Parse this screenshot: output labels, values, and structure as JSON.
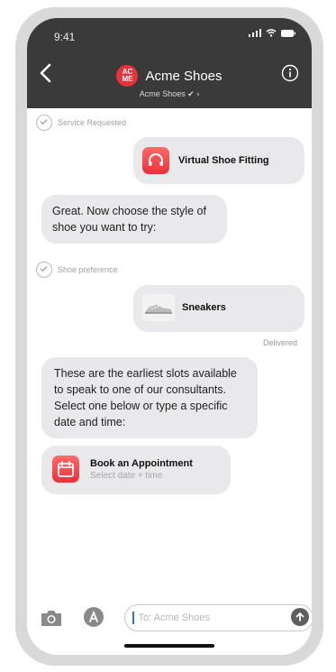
{
  "status_bar": {
    "time": "9:41"
  },
  "header": {
    "logo_text": "AC\nME",
    "title": "Acme Shoes",
    "subtitle": "Acme Shoes ✔ ›"
  },
  "messages": {
    "service_status": "Service Requested",
    "virtual_fitting": {
      "title": "Virtual Shoe Fitting"
    },
    "style_prompt": "Great. Now choose the style of shoe you want to try:",
    "shoe_status": "Shoe preference",
    "sneakers": {
      "title": "Sneakers"
    },
    "delivered": "Delivered",
    "slots_text": "These are the earliest slots available to speak to one of our consultants. Select one below or type a specific date and time:",
    "appointment": {
      "title": "Book an Appointment",
      "subtitle": "Select date + time"
    }
  },
  "composer": {
    "placeholder": "To: Acme Shoes"
  },
  "colors": {
    "header_bg": "#3a3a3a",
    "accent_red": "#e8323a",
    "bubble_gray": "#e9e9eb"
  }
}
